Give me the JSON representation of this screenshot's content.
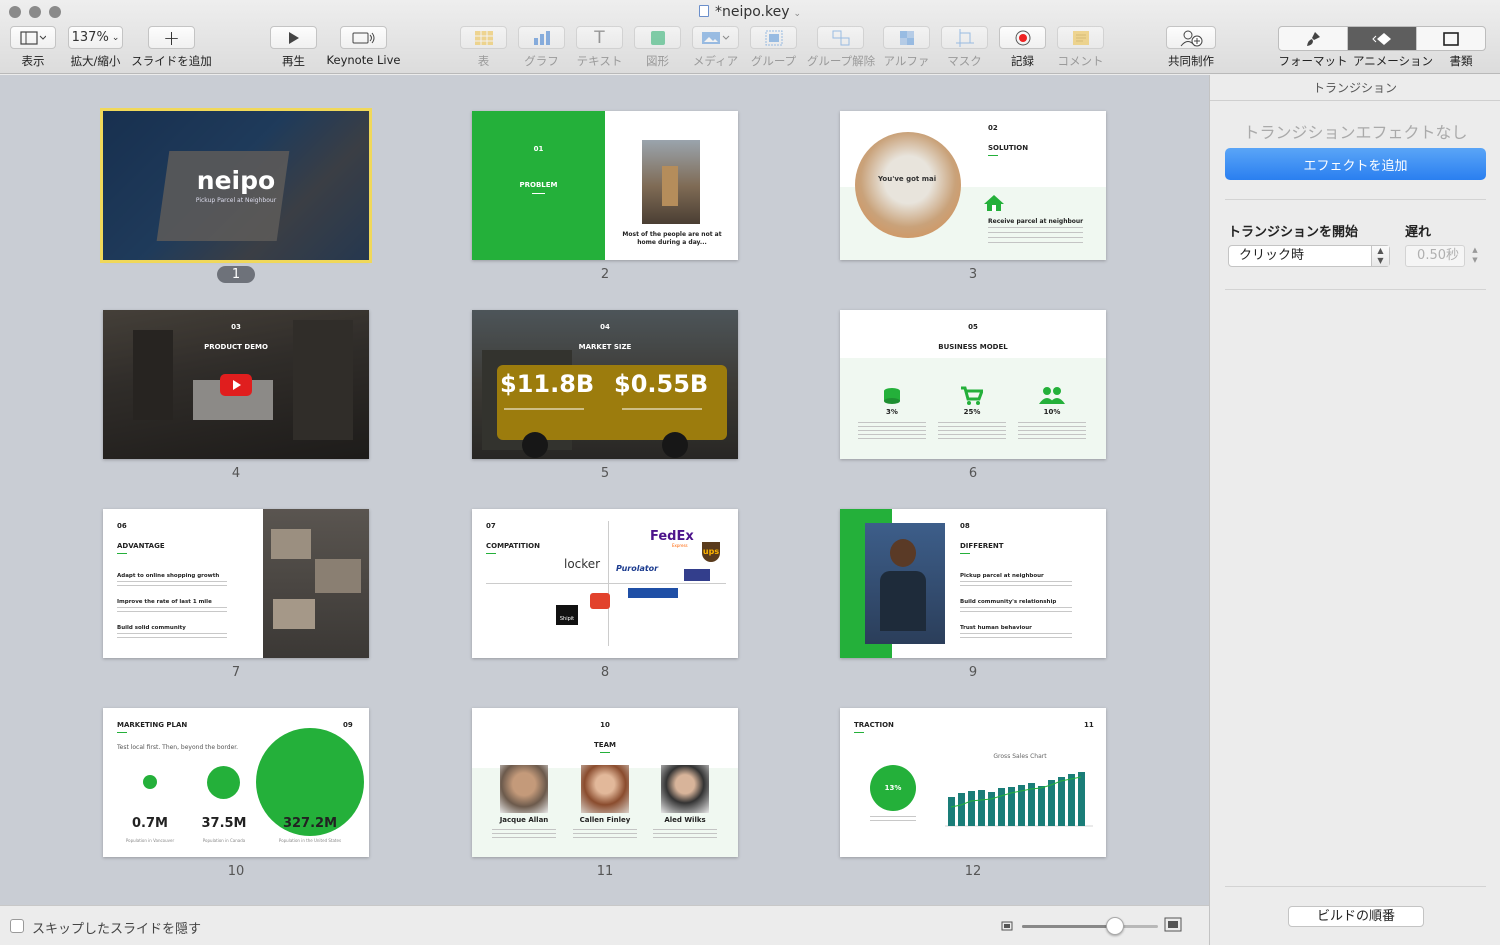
{
  "window": {
    "title": "*neipo.key"
  },
  "toolbar": {
    "view": "表示",
    "zoom_value": "137%",
    "zoom": "拡大/縮小",
    "add_slide": "スライドを追加",
    "play": "再生",
    "keynote_live": "Keynote Live",
    "table": "表",
    "chart": "グラフ",
    "text": "テキスト",
    "shape": "図形",
    "media": "メディア",
    "group": "グループ",
    "ungroup": "グループ解除",
    "alpha": "アルファ",
    "mask": "マスク",
    "record": "記録",
    "comment": "コメント",
    "collaborate": "共同制作",
    "format": "フォーマット",
    "animation": "アニメーション",
    "document": "書類"
  },
  "sidebar": {
    "header": "トランジション",
    "no_effect": "トランジションエフェクトなし",
    "add_effect": "エフェクトを追加",
    "start_label": "トランジションを開始",
    "start_value": "クリック時",
    "delay_label": "遅れ",
    "delay_value": "0.50秒",
    "build_order": "ビルドの順番"
  },
  "bottom": {
    "hide_skipped": "スキップしたスライドを隠す"
  },
  "colors": {
    "accent_green": "#24b03a",
    "selection": "#f0d85a",
    "button_blue": "#2a7ff0"
  },
  "slides": [
    {
      "number": "1",
      "title": "neipo",
      "subtitle": "Pickup Parcel at Neighbour"
    },
    {
      "number": "2",
      "index": "01",
      "title": "PROBLEM",
      "caption": "Most of the people are not at home during a day..."
    },
    {
      "number": "3",
      "index": "02",
      "title": "SOLUTION",
      "heading": "Receive parcel at neighbour",
      "photo_text": "You've got mai"
    },
    {
      "number": "4",
      "index": "03",
      "title": "PRODUCT DEMO"
    },
    {
      "number": "5",
      "index": "04",
      "title": "MARKET SIZE",
      "value1": "$11.8B",
      "value2": "$0.55B"
    },
    {
      "number": "6",
      "index": "05",
      "title": "BUSINESS MODEL",
      "stat1": "3%",
      "stat2": "25%",
      "stat3": "10%"
    },
    {
      "number": "7",
      "index": "06",
      "title": "ADVANTAGE",
      "item1": "Adapt to online shopping growth",
      "item2": "Improve the rate of last 1 mile",
      "item3": "Build solid community"
    },
    {
      "number": "8",
      "index": "07",
      "title": "COMPATITION",
      "logo_fedex": "FedEx",
      "logo_fedex_sub": "Express",
      "logo_locker": "locker",
      "logo_purolator": "Purolator",
      "logo_ups": "ups",
      "logo_shipit": "Shipit"
    },
    {
      "number": "9",
      "index": "08",
      "title": "DIFFERENT",
      "item1": "Pickup parcel at neighbour",
      "item2": "Build community's relationship",
      "item3": "Trust human behaviour"
    },
    {
      "number": "10",
      "index": "09",
      "title": "MARKETING PLAN",
      "tagline": "Test local first. Then, beyond the border.",
      "v1": "0.7M",
      "v2": "37.5M",
      "v3": "327.2M",
      "l1": "Population in Vancouver",
      "l2": "Population in Canada",
      "l3": "Population in the United States"
    },
    {
      "number": "11",
      "index": "10",
      "title": "TEAM",
      "p1": "Jacque Allan",
      "p2": "Callen Finley",
      "p3": "Aled Wilks"
    },
    {
      "number": "12",
      "index": "11",
      "title": "TRACTION",
      "circle": "13%",
      "chart_title": "Gross Sales Chart"
    }
  ]
}
